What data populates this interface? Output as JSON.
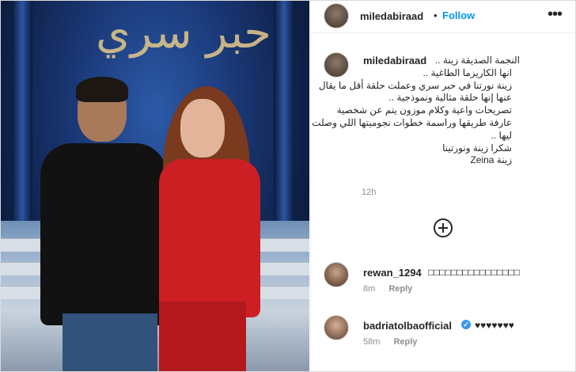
{
  "header": {
    "username": "miledabiraad",
    "separator": "•",
    "follow_label": "Follow",
    "more_label": "•••"
  },
  "photo": {
    "stage_title": "حبر سري"
  },
  "caption": {
    "username": "miledabiraad",
    "lines": [
      "النجمة الصديقة زينة ..",
      "انها الكاريزما الطاغية ..",
      "زينة نورتنا في حبر سري وعملت حلقة أقل ما يقال",
      "عنها إنها حلقة مثالية ونموذجية ..",
      "تصريحات واعية وكلام موزون ينم عن شخصية",
      "عارفة طريقها وراسمة خطوات نجوميتها اللي وصلت",
      "ليها ..",
      "شكرا زينة ونورتينا",
      "زينة Zeina"
    ],
    "time": "12h"
  },
  "comments": [
    {
      "username": "rewan_1294",
      "text": "□□□□□□□□□□□□□□□□",
      "verified": false,
      "time": "8m",
      "reply_label": "Reply"
    },
    {
      "username": "badriatolbaofficial",
      "text": "♥♥♥♥♥♥♥",
      "verified": true,
      "verified_mark": "✓",
      "time": "58m",
      "reply_label": "Reply"
    }
  ],
  "icons": {
    "add_comment": "plus-circle-icon",
    "more": "more-options-icon"
  },
  "colors": {
    "accent": "#0095f6",
    "verified": "#3897f0",
    "dress": "#cc1f24"
  }
}
